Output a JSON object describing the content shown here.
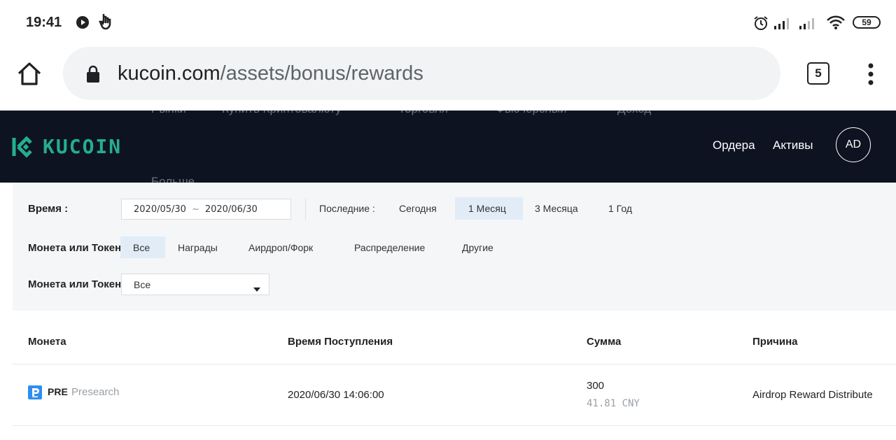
{
  "status_bar": {
    "time": "19:41",
    "battery": "59",
    "icons": [
      "play-icon",
      "touch-icon",
      "alarm-icon",
      "signal-icon",
      "signal-icon",
      "wifi-icon",
      "battery-icon"
    ]
  },
  "browser": {
    "url_domain": "kucoin.com",
    "url_path": "/assets/bonus/rewards",
    "tab_count": "5"
  },
  "header": {
    "logo": "KUCOIN",
    "nav_partial": [
      "Рынки",
      "Купить Криптовалюту",
      "Торговля",
      "Фьючерсный",
      "Доход",
      "Больше"
    ],
    "orders": "Ордера",
    "assets": "Активы",
    "avatar": "AD",
    "colors": {
      "bg": "#0d1320",
      "brand": "#24ae8f"
    }
  },
  "filters": {
    "time_label": "Время :",
    "date_from": "2020/05/30",
    "date_sep": "~",
    "date_to": "2020/06/30",
    "recent_label": "Последние :",
    "period_options": [
      "Сегодня",
      "1 Месяц",
      "3 Месяца",
      "1 Год"
    ],
    "period_selected": "1 Месяц",
    "type_label": "Монета или Токен",
    "type_options": [
      "Все",
      "Награды",
      "Аирдроп/Форк",
      "Распределение",
      "Другие"
    ],
    "type_selected": "Все",
    "coin_label": "Монета или Токен",
    "coin_value": "Все"
  },
  "table": {
    "headers": [
      "Монета",
      "Время Поступления",
      "Сумма",
      "Причина"
    ],
    "rows": [
      {
        "coin_symbol": "PRE",
        "coin_name": "Presearch",
        "time": "2020/06/30 14:06:00",
        "amount": "300",
        "amount_cny": "41.81 CNY",
        "reason": "Airdrop Reward Distribute"
      }
    ]
  }
}
